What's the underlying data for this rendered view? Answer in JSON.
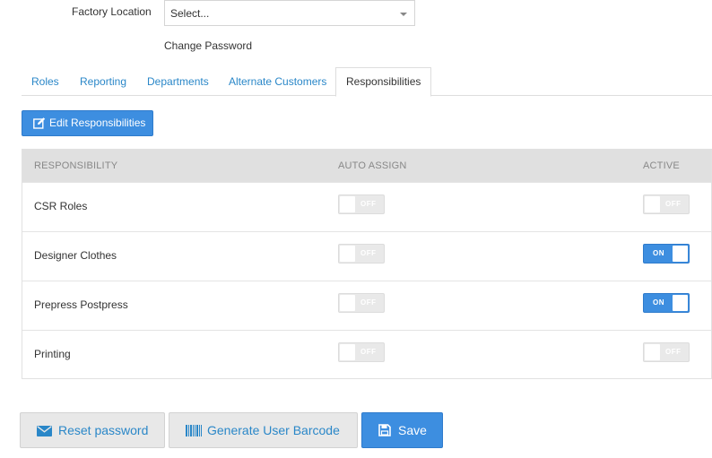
{
  "form": {
    "factory_location_label": "Factory Location",
    "factory_location_value": "Select...",
    "change_password_link": "Change Password"
  },
  "tabs": [
    {
      "label": "Roles",
      "active": false
    },
    {
      "label": "Reporting",
      "active": false
    },
    {
      "label": "Departments",
      "active": false
    },
    {
      "label": "Alternate Customers",
      "active": false
    },
    {
      "label": "Responsibilities",
      "active": true
    }
  ],
  "edit_button": {
    "label": "Edit Responsibilities",
    "icon": "edit-icon"
  },
  "table": {
    "headers": [
      "RESPONSIBILITY",
      "AUTO ASSIGN",
      "ACTIVE"
    ],
    "rows": [
      {
        "name": "CSR Roles",
        "auto_assign": "OFF",
        "active": "OFF"
      },
      {
        "name": "Designer Clothes",
        "auto_assign": "OFF",
        "active": "ON"
      },
      {
        "name": "Prepress Postpress",
        "auto_assign": "OFF",
        "active": "ON"
      },
      {
        "name": "Printing",
        "auto_assign": "OFF",
        "active": "OFF"
      }
    ]
  },
  "footer": {
    "reset_password": {
      "label": "Reset password",
      "icon": "envelope-icon"
    },
    "generate_barcode": {
      "label": "Generate User Barcode",
      "icon": "barcode-icon"
    },
    "save": {
      "label": "Save",
      "icon": "save-icon"
    }
  },
  "colors": {
    "accent": "#3d8ee0",
    "link": "#2a87c8",
    "header_bg": "#e0e0e0",
    "toggle_off": "#e9e9e9"
  }
}
